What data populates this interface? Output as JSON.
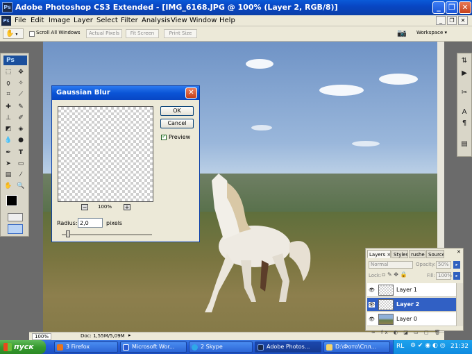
{
  "window": {
    "app_icon": "Ps",
    "title": "Adobe Photoshop CS3 Extended - [IMG_6168.JPG @ 100% (Layer 2, RGB/8)]",
    "controls": [
      "minimize-icon",
      "restore-icon",
      "close-icon"
    ]
  },
  "menu": {
    "app_icon": "Ps",
    "items": [
      "File",
      "Edit",
      "Image",
      "Layer",
      "Select",
      "Filter",
      "Analysis",
      "View",
      "Window",
      "Help"
    ]
  },
  "options_bar": {
    "tool_icon": "hand-icon",
    "scroll_all_windows": "Scroll All Windows",
    "buttons": [
      "Actual Pixels",
      "Fit Screen",
      "Print Size"
    ],
    "workspace": "Workspace ▾"
  },
  "toolbox": {
    "logo": "Ps"
  },
  "dialog": {
    "title": "Gaussian Blur",
    "ok": "OK",
    "cancel": "Cancel",
    "preview_label": "Preview",
    "preview_checked": true,
    "zoom_minus": "−",
    "zoom_value": "100%",
    "zoom_plus": "+",
    "radius_label": "Radius:",
    "radius_value": "2,0",
    "radius_unit": "pixels"
  },
  "status_bar": {
    "zoom": "100%",
    "doc": "Doc: 1,55M/5,09M"
  },
  "layers_panel": {
    "tabs": [
      "Layers ×",
      "Styles",
      "rushes",
      "Source"
    ],
    "blend_mode": "Normal",
    "opacity_label": "Opacity:",
    "opacity_value": "50%",
    "lock_label": "Lock:",
    "fill_label": "Fill:",
    "fill_value": "100%",
    "layers": [
      {
        "name": "Layer 1",
        "selected": false
      },
      {
        "name": "Layer 2",
        "selected": true
      },
      {
        "name": "Layer 0",
        "selected": false
      }
    ]
  },
  "taskbar": {
    "start": "пуск",
    "tasks": [
      "3 Firefox",
      "Microsoft Wor...",
      "2 Skype",
      "Adobe Photos...",
      "D:\\Фото\\Спл..."
    ],
    "lang": "RL",
    "time": "21:32"
  }
}
